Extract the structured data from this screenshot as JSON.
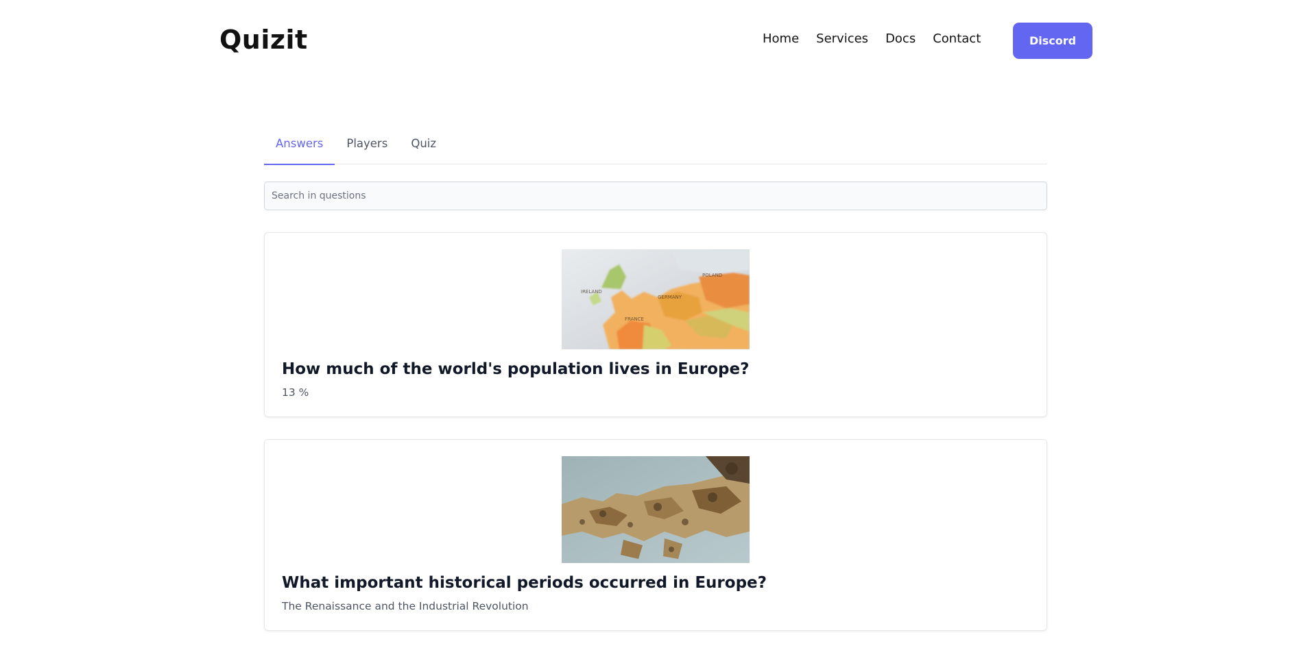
{
  "brand": "Quizit",
  "nav": {
    "items": [
      "Home",
      "Services",
      "Docs",
      "Contact"
    ],
    "cta_label": "Discord"
  },
  "tabs": [
    {
      "label": "Answers",
      "active": true
    },
    {
      "label": "Players",
      "active": false
    },
    {
      "label": "Quiz",
      "active": false
    }
  ],
  "search": {
    "placeholder": "Search in questions",
    "value": ""
  },
  "cards": [
    {
      "image_alt": "map of Europe",
      "question": "How much of the world's population lives in Europe?",
      "answer": "13 %"
    },
    {
      "image_alt": "illustrated historical map of Europe",
      "question": "What important historical periods occurred in Europe?",
      "answer": "The Renaissance and the Industrial Revolution"
    }
  ],
  "colors": {
    "accent": "#6366f1",
    "text": "#111827",
    "muted": "#4b5563",
    "border": "#e5e7eb"
  }
}
